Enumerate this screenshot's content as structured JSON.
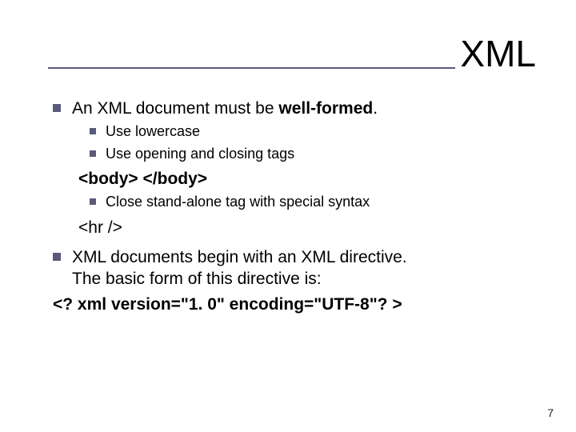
{
  "title": "XML",
  "bullets": {
    "main1_pre": "An XML document must be ",
    "main1_bold": "well-formed",
    "main1_post": ".",
    "sub1": "Use lowercase",
    "sub2": "Use opening and closing tags",
    "code1": "<body>     </body>",
    "sub3": "Close stand-alone tag with special syntax",
    "code2": "<hr  />",
    "main2_line1": "XML documents begin with an XML directive.",
    "main2_line2": "The basic form of this directive is:",
    "directive": "<? xml version=\"1. 0\" encoding=\"UTF-8\"? >"
  },
  "page_number": "7"
}
